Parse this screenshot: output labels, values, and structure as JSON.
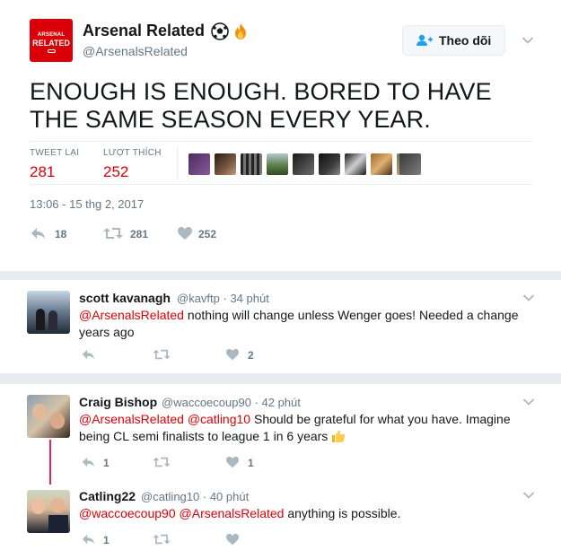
{
  "main_tweet": {
    "avatar_text_line1": "ARSENAL",
    "avatar_text_line2": "RELATED",
    "fullname": "Arsenal Related",
    "username": "@ArsenalsRelated",
    "follow_label": "Theo dõi",
    "text": "ENOUGH IS ENOUGH. BORED TO HAVE THE SAME SEASON EVERY YEAR.",
    "stats": {
      "retweets_label": "TWEET LẠI",
      "retweets_value": "281",
      "likes_label": "LƯỢT THÍCH",
      "likes_value": "252"
    },
    "timestamp": "13:06 - 15 thg 2, 2017",
    "actions": {
      "replies": "18",
      "retweets": "281",
      "likes": "252"
    }
  },
  "replies": [
    {
      "fullname": "scott kavanagh",
      "username": "@kavftp",
      "time": "· 34 phút",
      "mention1": "@ArsenalsRelated",
      "text": " nothing will change unless Wenger goes! Needed a change years ago",
      "likes": "2"
    },
    {
      "fullname": "Craig Bishop",
      "username": "@waccoecoup90",
      "time": "· 42 phút",
      "mention1": "@ArsenalsRelated",
      "mention2": "@catling10",
      "text": " Should be grateful for what you have. Imagine being CL semi finalists to league 1 in 6 years ",
      "replies": "1",
      "likes": "1"
    },
    {
      "fullname": "Catling22",
      "username": "@catling10",
      "time": "· 40 phút",
      "mention1": "@waccoecoup90",
      "mention2": "@ArsenalsRelated",
      "text": " anything is possible.",
      "replies": "1"
    }
  ],
  "colors": {
    "accent": "#db0007",
    "muted": "#657786",
    "border": "#e6ecf0",
    "thread": "#e0245e"
  }
}
